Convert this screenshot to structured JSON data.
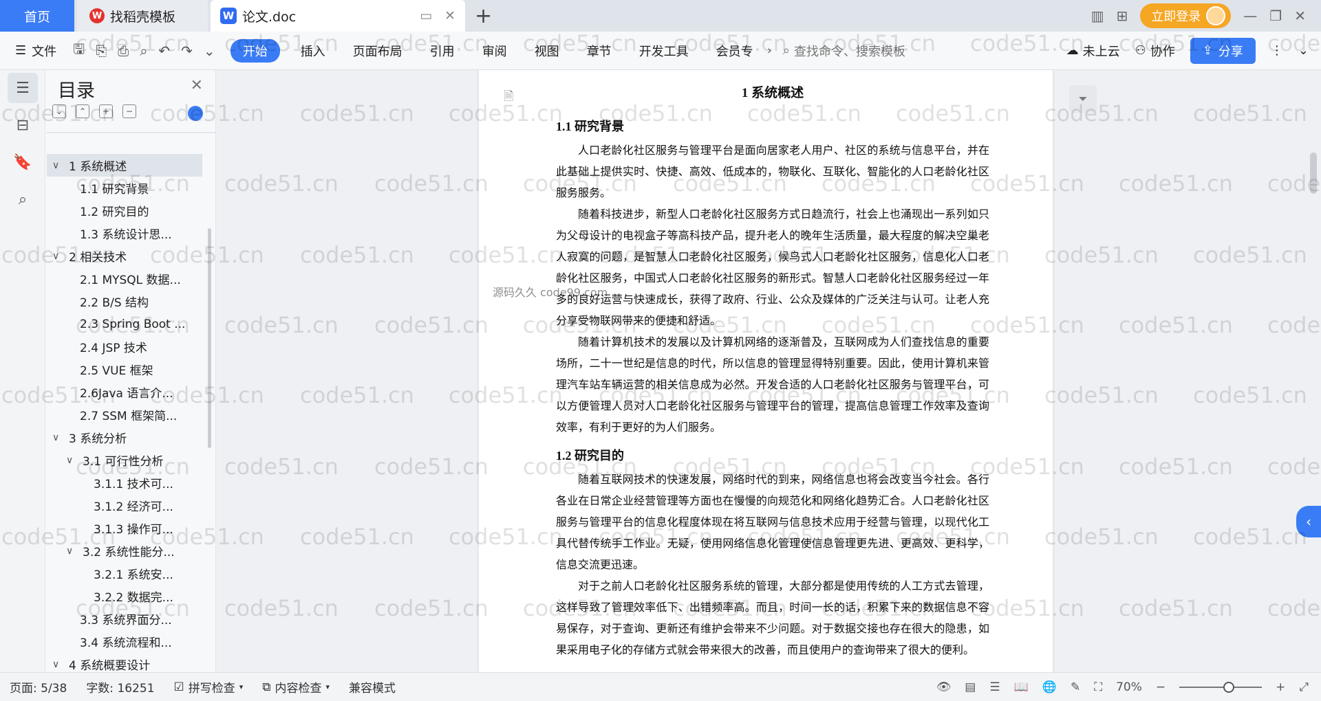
{
  "tabs": {
    "home": "首页",
    "daoke": "找稻壳模板",
    "doc": "论文.doc",
    "login": "立即登录"
  },
  "ribbon": {
    "file": "文件",
    "tabs": [
      "开始",
      "插入",
      "页面布局",
      "引用",
      "审阅",
      "视图",
      "章节",
      "开发工具",
      "会员专"
    ],
    "search_placeholder": "查找命令、搜索模板",
    "cloud": "未上云",
    "collab": "协作",
    "share": "分享"
  },
  "toc": {
    "title": "目录",
    "items": [
      {
        "label": "1 系统概述",
        "level": 0,
        "expanded": true,
        "selected": true
      },
      {
        "label": "1.1  研究背景",
        "level": 1
      },
      {
        "label": "1.2 研究目的",
        "level": 1
      },
      {
        "label": "1.3 系统设计思...",
        "level": 1
      },
      {
        "label": "2 相关技术",
        "level": 0,
        "expanded": true
      },
      {
        "label": "2.1 MYSQL 数据...",
        "level": 1
      },
      {
        "label": "2.2 B/S 结构",
        "level": 1
      },
      {
        "label": "2.3 Spring Boot ...",
        "level": 1
      },
      {
        "label": "2.4 JSP 技术",
        "level": 1
      },
      {
        "label": "2.5 VUE 框架",
        "level": 1
      },
      {
        "label": "2.6Java 语言介...",
        "level": 1
      },
      {
        "label": "2.7 SSM 框架简...",
        "level": 1
      },
      {
        "label": "3 系统分析",
        "level": 0,
        "expanded": true
      },
      {
        "label": "3.1 可行性分析",
        "level": 1,
        "expanded": true
      },
      {
        "label": "3.1.1 技术可...",
        "level": 2
      },
      {
        "label": "3.1.2 经济可...",
        "level": 2
      },
      {
        "label": "3.1.3 操作可...",
        "level": 2
      },
      {
        "label": "3.2 系统性能分...",
        "level": 1,
        "expanded": true
      },
      {
        "label": "3.2.1  系统安...",
        "level": 2
      },
      {
        "label": "3.2.2  数据完...",
        "level": 2
      },
      {
        "label": "3.3 系统界面分...",
        "level": 1
      },
      {
        "label": "3.4 系统流程和...",
        "level": 1
      },
      {
        "label": "4 系统概要设计",
        "level": 0,
        "expanded": true
      }
    ]
  },
  "document": {
    "h1": "1 系统概述",
    "sections": [
      {
        "heading": "1.1  研究背景",
        "paragraphs": [
          "人口老龄化社区服务与管理平台是面向居家老人用户、社区的系统与信息平台，并在此基础上提供实时、快捷、高效、低成本的，物联化、互联化、智能化的人口老龄化社区服务服务。",
          "随着科技进步，新型人口老龄化社区服务方式日趋流行，社会上也涌现出一系列如只为父母设计的电视盒子等高科技产品，提升老人的晚年生活质量，最大程度的解决空巢老人寂寞的问题，是智慧人口老龄化社区服务，候鸟式人口老龄化社区服务，信息化人口老龄化社区服务，中国式人口老龄化社区服务的新形式。智慧人口老龄化社区服务经过一年多的良好运营与快速成长，获得了政府、行业、公众及媒体的广泛关注与认可。让老人充分享受物联网带来的便捷和舒适。",
          "随着计算机技术的发展以及计算机网络的逐渐普及，互联网成为人们查找信息的重要场所，二十一世纪是信息的时代，所以信息的管理显得特别重要。因此，使用计算机来管理汽车站车辆运营的相关信息成为必然。开发合适的人口老龄化社区服务与管理平台，可以方便管理人员对人口老龄化社区服务与管理平台的管理，提高信息管理工作效率及查询效率，有利于更好的为人们服务。"
        ]
      },
      {
        "heading": "1.2 研究目的",
        "paragraphs": [
          "随着互联网技术的快速发展，网络时代的到来，网络信息也将会改变当今社会。各行各业在日常企业经营管理等方面也在慢慢的向规范化和网络化趋势汇合。人口老龄化社区服务与管理平台的信息化程度体现在将互联网与信息技术应用于经营与管理，以现代化工具代替传统手工作业。无疑，使用网络信息化管理使信息管理更先进、更高效、更科学，信息交流更迅速。",
          "对于之前人口老龄化社区服务系统的管理，大部分都是使用传统的人工方式去管理，这样导致了管理效率低下、出错频率高。而且，时间一长的话，积累下来的数据信息不容易保存，对于查询、更新还有维护会带来不少问题。对于数据交接也存在很大的隐患，如果采用电子化的存储方式就会带来很大的改善，而且使用户的查询带来了很大的便利。"
        ]
      }
    ],
    "overlay_text": "源码久久 code99.com"
  },
  "statusbar": {
    "page": "页面: 5/38",
    "words": "字数: 16251",
    "spell": "拼写检查",
    "content": "内容检查",
    "mode": "兼容模式",
    "zoom": "70%",
    "zoom_level": 0.7
  },
  "watermark": "code51.cn"
}
